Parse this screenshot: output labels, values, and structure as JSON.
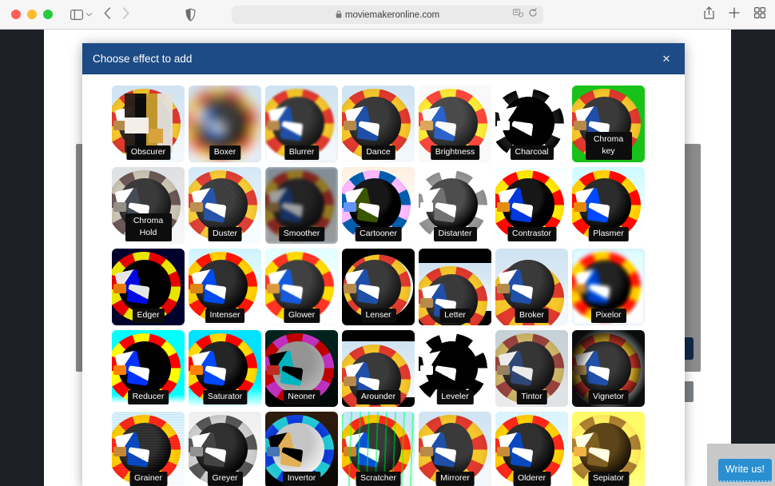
{
  "browser": {
    "url": "moviemakeronline.com",
    "lock_icon": "lock-icon",
    "traffic_lights": [
      "close",
      "minimize",
      "zoom"
    ],
    "icons": {
      "sidebar": "sidebar-icon",
      "sidebar_chevron": "chevron-down-icon",
      "back": "back-arrow-icon",
      "forward": "forward-arrow-icon",
      "shield": "privacy-shield-icon",
      "reader": "page-settings-icon",
      "reload": "reload-icon",
      "share": "share-icon",
      "new_tab": "plus-icon",
      "tab_overview": "tab-overview-icon"
    }
  },
  "modal": {
    "title": "Choose effect to add",
    "close_label": "✕",
    "header_color": "#1d4b85"
  },
  "widget": {
    "write_us_label": "Write us!",
    "accent_color": "#2a8fd0"
  },
  "effects": [
    {
      "label": "Obscurer",
      "style": "f-obscure",
      "lines": 1
    },
    {
      "label": "Boxer",
      "style": "f-box",
      "lines": 1
    },
    {
      "label": "Blurrer",
      "style": "f-blur",
      "lines": 1
    },
    {
      "label": "Dance",
      "style": "f-dance",
      "lines": 1
    },
    {
      "label": "Brightness",
      "style": "f-bright",
      "lines": 1
    },
    {
      "label": "Charcoal",
      "style": "f-charcoal",
      "lines": 1
    },
    {
      "label": "Chroma key",
      "style": "f-chromakey",
      "lines": 2
    },
    {
      "label": "Chroma Hold",
      "style": "f-chromahold",
      "lines": 2
    },
    {
      "label": "Duster",
      "style": "f-duster",
      "lines": 1
    },
    {
      "label": "Smoother",
      "style": "f-smoother",
      "lines": 1
    },
    {
      "label": "Cartooner",
      "style": "f-cartoon",
      "lines": 1
    },
    {
      "label": "Distanter",
      "style": "f-distant",
      "lines": 1
    },
    {
      "label": "Contrastor",
      "style": "f-contrast",
      "lines": 1
    },
    {
      "label": "Plasmer",
      "style": "f-plasmer",
      "lines": 1
    },
    {
      "label": "Edger",
      "style": "f-edger",
      "lines": 1
    },
    {
      "label": "Intenser",
      "style": "f-intenser",
      "lines": 1
    },
    {
      "label": "Glower",
      "style": "f-glower",
      "lines": 1
    },
    {
      "label": "Lenser",
      "style": "f-lenser",
      "lines": 1
    },
    {
      "label": "Letter",
      "style": "f-letter",
      "lines": 1
    },
    {
      "label": "Broker",
      "style": "f-broker",
      "lines": 1
    },
    {
      "label": "Pixelor",
      "style": "f-pixelor",
      "lines": 1
    },
    {
      "label": "Reducer",
      "style": "f-reducer",
      "lines": 1
    },
    {
      "label": "Saturator",
      "style": "f-saturator",
      "lines": 1
    },
    {
      "label": "Neoner",
      "style": "f-neoner",
      "lines": 1
    },
    {
      "label": "Arounder",
      "style": "f-arounder",
      "lines": 1
    },
    {
      "label": "Leveler",
      "style": "f-leveler",
      "lines": 1
    },
    {
      "label": "Tintor",
      "style": "f-tintor",
      "lines": 1
    },
    {
      "label": "Vignetor",
      "style": "f-vignetor",
      "lines": 1
    },
    {
      "label": "Grainer",
      "style": "f-grainer",
      "lines": 1
    },
    {
      "label": "Greyer",
      "style": "f-greyer",
      "lines": 1
    },
    {
      "label": "Invertor",
      "style": "f-invertor",
      "lines": 1
    },
    {
      "label": "Scratcher",
      "style": "f-scratcher",
      "lines": 1
    },
    {
      "label": "Mirrorer",
      "style": "f-mirrorer",
      "lines": 1
    },
    {
      "label": "Olderer",
      "style": "f-olderer",
      "lines": 1
    },
    {
      "label": "Sepiator",
      "style": "f-sepiator",
      "lines": 1
    }
  ]
}
